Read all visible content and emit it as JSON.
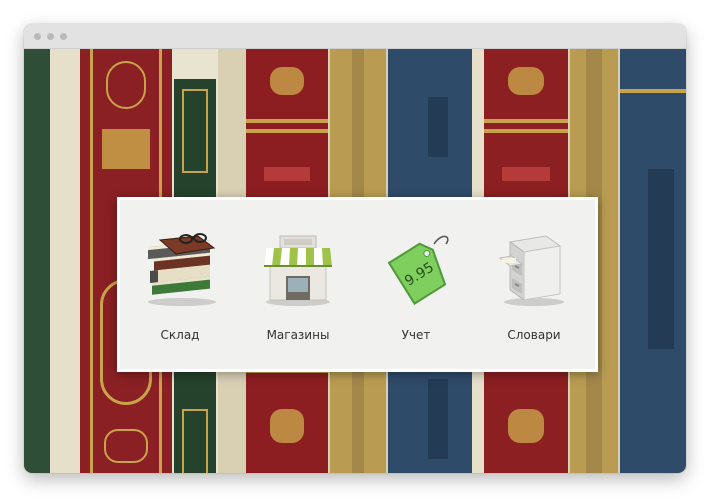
{
  "window": {
    "controls": [
      "window-dot",
      "window-dot",
      "window-dot"
    ]
  },
  "background": {
    "description_colors": [
      "#2e4b34",
      "#8a1f22",
      "#c8a44c",
      "#2f4c6b",
      "#e9e4d0"
    ]
  },
  "launcher": {
    "items": [
      {
        "label": "Склад",
        "icon": "books-with-glasses-icon"
      },
      {
        "label": "Магазины",
        "icon": "storefront-icon"
      },
      {
        "label": "Учет",
        "icon": "price-tag-icon",
        "tag_text": "9.95"
      },
      {
        "label": "Словари",
        "icon": "filing-cabinet-icon"
      }
    ]
  }
}
